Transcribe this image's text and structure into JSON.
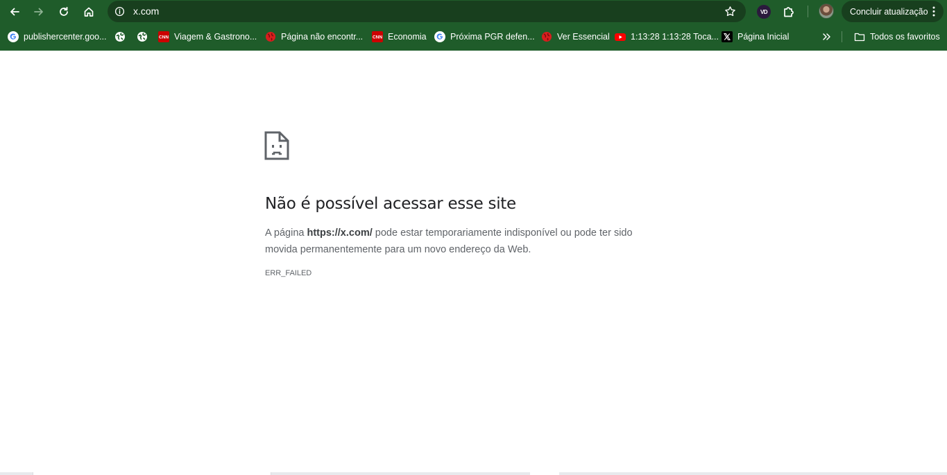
{
  "browser": {
    "url": "x.com",
    "update_button_label": "Concluir atualização",
    "extension_badge": "VD",
    "colors": {
      "frame": "#1f5c2a",
      "omnibox": "#183f1e",
      "text": "#ffffff"
    }
  },
  "bookmarks": {
    "items": [
      {
        "label": "publishercenter.goo...",
        "icon": "google-icon"
      },
      {
        "label": "",
        "icon": "globe-icon"
      },
      {
        "label": "",
        "icon": "globe-icon"
      },
      {
        "label": "Viagem & Gastrono...",
        "icon": "cnn-icon"
      },
      {
        "label": "Página não encontr...",
        "icon": "red-globe-icon"
      },
      {
        "label": "Economia",
        "icon": "cnn-icon"
      },
      {
        "label": "Próxima PGR defen...",
        "icon": "google-icon"
      },
      {
        "label": "Ver Essencial",
        "icon": "red-globe-icon"
      },
      {
        "label": "1:13:28 1:13:28 Toca...",
        "icon": "youtube-icon"
      },
      {
        "label": "Página Inicial",
        "icon": "x-icon"
      }
    ],
    "overflow_icon": "double-chevron-icon",
    "all_bookmarks_label": "Todos os favoritos"
  },
  "error_page": {
    "icon": "sad-page-icon",
    "title": "Não é possível acessar esse site",
    "body_prefix": "A página ",
    "body_url": "https://x.com/",
    "body_suffix": " pode estar temporariamente indisponível ou pode ter sido movida permanentemente para um novo endereço da Web.",
    "error_code": "ERR_FAILED"
  }
}
